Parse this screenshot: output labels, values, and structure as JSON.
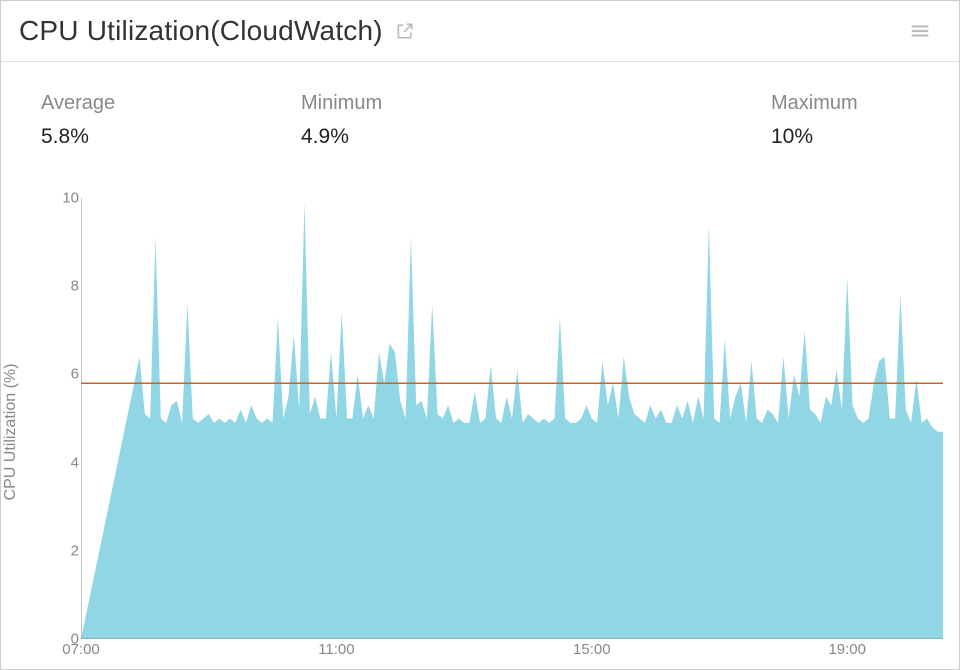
{
  "header": {
    "title": "CPU Utilization(CloudWatch)"
  },
  "stats": {
    "average": {
      "label": "Average",
      "value": "5.8%"
    },
    "minimum": {
      "label": "Minimum",
      "value": "4.9%"
    },
    "maximum": {
      "label": "Maximum",
      "value": "10%"
    }
  },
  "chart_data": {
    "type": "area",
    "title": "CPU Utilization(CloudWatch)",
    "xlabel": "",
    "ylabel": "CPU Utilization (%)",
    "ylim": [
      0,
      10
    ],
    "x_ticks": [
      "07:00",
      "11:00",
      "15:00",
      "19:00"
    ],
    "y_ticks": [
      0,
      2,
      4,
      6,
      8,
      10
    ],
    "x_range_minutes": [
      420,
      1230
    ],
    "average_line": 5.8,
    "colors": {
      "area": "#8ad4e3",
      "average_line": "#c86428"
    },
    "series": [
      {
        "name": "CPU Utilization",
        "x_minutes": [
          420,
          470,
          475,
          480,
          485,
          490,
          495,
          500,
          505,
          510,
          515,
          520,
          525,
          530,
          535,
          540,
          545,
          550,
          555,
          560,
          565,
          570,
          575,
          580,
          585,
          590,
          595,
          600,
          605,
          610,
          615,
          620,
          625,
          630,
          635,
          640,
          645,
          650,
          655,
          660,
          665,
          670,
          675,
          680,
          685,
          690,
          695,
          700,
          705,
          710,
          715,
          720,
          725,
          730,
          735,
          740,
          745,
          750,
          755,
          760,
          765,
          770,
          775,
          780,
          785,
          790,
          795,
          800,
          805,
          810,
          815,
          820,
          825,
          830,
          835,
          840,
          845,
          850,
          855,
          860,
          865,
          870,
          875,
          880,
          885,
          890,
          895,
          900,
          905,
          910,
          915,
          920,
          925,
          930,
          935,
          940,
          945,
          950,
          955,
          960,
          965,
          970,
          975,
          980,
          985,
          990,
          995,
          1000,
          1005,
          1010,
          1015,
          1020,
          1025,
          1030,
          1035,
          1040,
          1045,
          1050,
          1055,
          1060,
          1065,
          1070,
          1075,
          1080,
          1085,
          1090,
          1095,
          1100,
          1105,
          1110,
          1115,
          1120,
          1125,
          1130,
          1135,
          1140,
          1145,
          1150,
          1155,
          1160,
          1165,
          1170,
          1175,
          1180,
          1185,
          1190,
          1195,
          1200,
          1205,
          1210,
          1215,
          1220,
          1225,
          1230
        ],
        "values": [
          0,
          5.8,
          6.4,
          5.1,
          5.0,
          9.1,
          5.0,
          4.9,
          5.3,
          5.4,
          4.9,
          7.6,
          5.0,
          4.9,
          5.0,
          5.1,
          4.9,
          5.0,
          4.9,
          5.0,
          4.9,
          5.2,
          4.9,
          5.3,
          5.0,
          4.9,
          5.0,
          4.9,
          7.3,
          5.0,
          5.5,
          6.9,
          5.2,
          9.9,
          5.1,
          5.5,
          5.0,
          5.0,
          6.5,
          5.0,
          7.4,
          5.0,
          5.0,
          6.0,
          5.0,
          5.3,
          5.0,
          6.5,
          5.8,
          6.7,
          6.5,
          5.4,
          5.0,
          9.1,
          5.3,
          5.4,
          5.0,
          7.6,
          5.1,
          5.0,
          5.3,
          4.9,
          5.0,
          4.9,
          4.9,
          5.6,
          4.9,
          5.0,
          6.2,
          5.0,
          4.9,
          5.5,
          5.0,
          6.1,
          4.9,
          5.1,
          5.0,
          4.9,
          5.0,
          4.9,
          5.0,
          7.3,
          5.0,
          4.9,
          4.9,
          5.0,
          5.3,
          5.0,
          4.9,
          6.3,
          5.3,
          5.8,
          5.0,
          6.4,
          5.5,
          5.1,
          5.0,
          4.9,
          5.3,
          5.0,
          5.2,
          4.9,
          4.9,
          5.3,
          5.0,
          5.4,
          4.9,
          5.5,
          5.0,
          9.4,
          5.0,
          4.9,
          6.8,
          5.0,
          5.5,
          5.8,
          4.9,
          6.3,
          5.0,
          4.9,
          5.2,
          5.1,
          4.9,
          6.4,
          5.0,
          6.0,
          5.5,
          7.0,
          5.2,
          5.1,
          4.9,
          5.5,
          5.3,
          6.1,
          5.2,
          8.2,
          5.3,
          5.0,
          4.9,
          5.0,
          5.8,
          6.3,
          6.4,
          5.0,
          5.0,
          7.8,
          5.2,
          4.9,
          5.9,
          4.9,
          5.0,
          4.8,
          4.7,
          4.7
        ]
      }
    ]
  }
}
